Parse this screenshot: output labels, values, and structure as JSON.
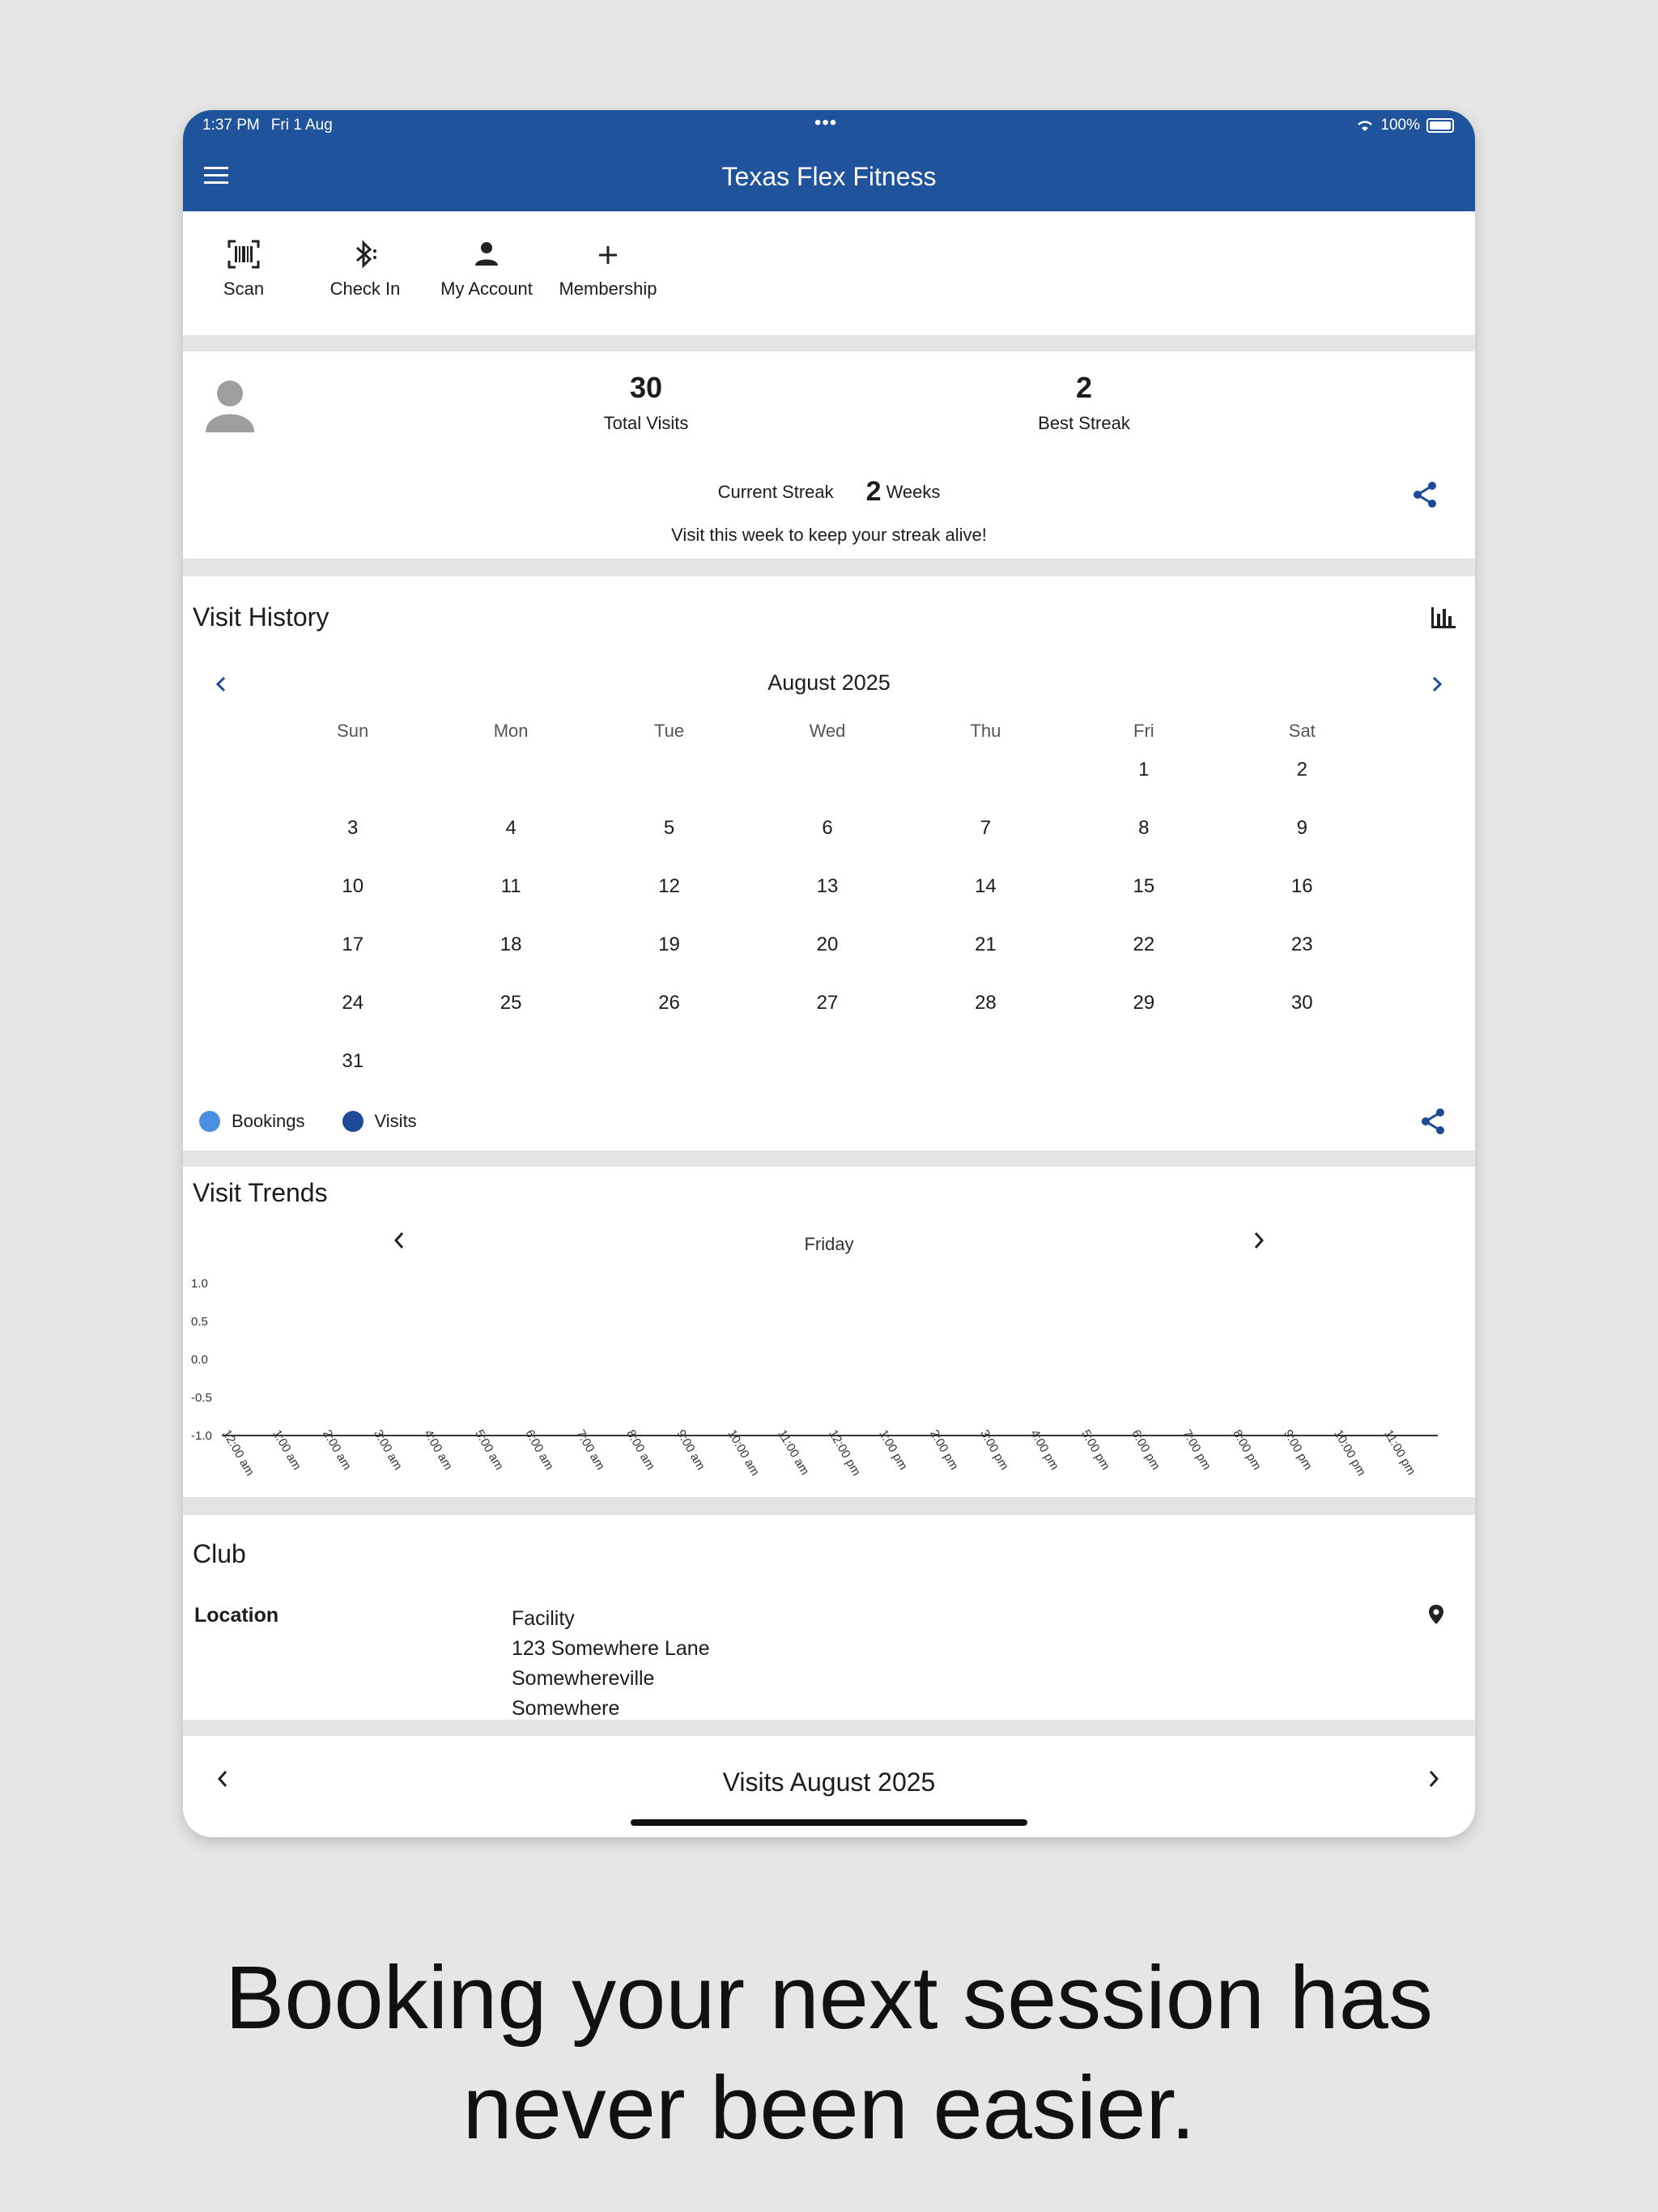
{
  "status_bar": {
    "time": "1:37 PM",
    "date": "Fri 1 Aug",
    "dots": "•••",
    "battery": "100%"
  },
  "app_bar": {
    "title": "Texas Flex Fitness",
    "menu_icon": "hamburger-menu-icon"
  },
  "toolbar": {
    "items": [
      {
        "label": "Scan",
        "icon": "barcode-scan-icon"
      },
      {
        "label": "Check In",
        "icon": "bluetooth-icon"
      },
      {
        "label": "My Account",
        "icon": "person-icon"
      },
      {
        "label": "Membership",
        "icon": "plus-icon"
      }
    ]
  },
  "profile": {
    "total_visits": "30",
    "total_visits_label": "Total Visits",
    "best_streak": "2",
    "best_streak_label": "Best Streak",
    "current_streak_label": "Current Streak",
    "current_streak_value": "2",
    "current_streak_unit": "Weeks",
    "streak_message": "Visit this week to keep your streak alive!"
  },
  "visit_history": {
    "title": "Visit History",
    "month": "August 2025",
    "weekdays": [
      "Sun",
      "Mon",
      "Tue",
      "Wed",
      "Thu",
      "Fri",
      "Sat"
    ],
    "weeks": [
      [
        "",
        "",
        "",
        "",
        "",
        "1",
        "2"
      ],
      [
        "3",
        "4",
        "5",
        "6",
        "7",
        "8",
        "9"
      ],
      [
        "10",
        "11",
        "12",
        "13",
        "14",
        "15",
        "16"
      ],
      [
        "17",
        "18",
        "19",
        "20",
        "21",
        "22",
        "23"
      ],
      [
        "24",
        "25",
        "26",
        "27",
        "28",
        "29",
        "30"
      ],
      [
        "31",
        "",
        "",
        "",
        "",
        "",
        ""
      ]
    ],
    "legend": [
      {
        "label": "Bookings",
        "color": "#4a8fe0"
      },
      {
        "label": "Visits",
        "color": "#1d4b97"
      }
    ]
  },
  "visit_trends": {
    "title": "Visit Trends",
    "day": "Friday",
    "y_ticks": [
      "1.0",
      "0.5",
      "0.0",
      "-0.5",
      "-1.0"
    ],
    "x_ticks": [
      "12:00 am",
      "1:00 am",
      "2:00 am",
      "3:00 am",
      "4:00 am",
      "5:00 am",
      "6:00 am",
      "7:00 am",
      "8:00 am",
      "9:00 am",
      "10:00 am",
      "11:00 am",
      "12:00 pm",
      "1:00 pm",
      "2:00 pm",
      "3:00 pm",
      "4:00 pm",
      "5:00 pm",
      "6:00 pm",
      "7:00 pm",
      "8:00 pm",
      "9:00 pm",
      "10:00 pm",
      "11:00 pm"
    ]
  },
  "club": {
    "title": "Club",
    "location_label": "Location",
    "address_lines": [
      "Facility",
      "123 Somewhere Lane",
      "Somewhereville",
      "Somewhere"
    ]
  },
  "visits_footer": {
    "title": "Visits August 2025"
  },
  "tagline": {
    "line1": "Booking your next session has",
    "line2": "never been easier."
  },
  "colors": {
    "primary": "#1f549c",
    "accent": "#1d4b97",
    "bookings": "#4a8fe0"
  }
}
